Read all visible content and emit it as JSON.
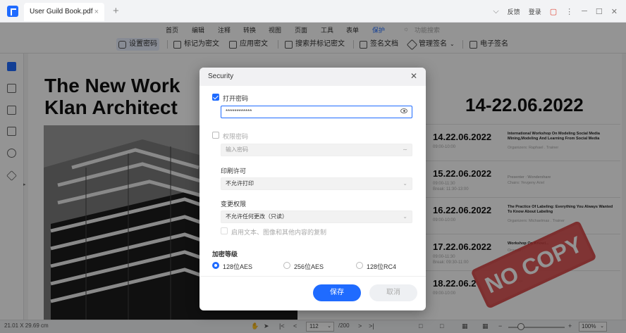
{
  "titlebar": {
    "tab_title": "User Guild Book.pdf",
    "close": "×",
    "new_tab": "+",
    "feedback": "反馈",
    "login": "登录",
    "more": "⋮",
    "minimize": "─",
    "maximize": "☐",
    "close_window": "✕",
    "chevron": "⌵"
  },
  "menu": {
    "items": [
      "首页",
      "编辑",
      "注释",
      "转换",
      "视图",
      "页面",
      "工具",
      "表单",
      "保护"
    ],
    "active": "保护",
    "search_placeholder": "功能搜索"
  },
  "toolbar": {
    "items": [
      "设置密码",
      "标记为密文",
      "应用密文",
      "搜索并标记密文",
      "签名文档",
      "管理签名",
      "电子签名"
    ]
  },
  "document": {
    "title_line1": "The New Work",
    "title_line2": "Klan Architect",
    "date_range": "14-22.06.2022",
    "schedule": [
      {
        "date": "14.22.06.2022",
        "time": "09:00-10:00",
        "title": "International Workshop On Modeling Social Media Mining,Modeling And Learning From Social Media",
        "organizer": "Organizers: Raphael . Trainer"
      },
      {
        "date": "15.22.06.2022",
        "time": "09:00-11:30",
        "break": "Break: 11:30-13:00",
        "title": "Presenter : Wondershare",
        "organizer": "Chairs: Yevgeny Ariel"
      },
      {
        "date": "16.22.06.2022",
        "time": "09:00-10:00",
        "title": "The Practice Of Labeling: Everything You Always Wanted To Know About Labeling",
        "organizer": "Organizers: Michaelmas . Trainer"
      },
      {
        "date": "17.22.06.2022",
        "time": "09:00-11:30",
        "break": "Break: 09:30-11:00",
        "title": "Workshop On Knowl...",
        "organizer": "Organiz..."
      },
      {
        "date": "18.22.06.2",
        "time": "09:00-10:00",
        "title": "",
        "organizer": "...Trainer"
      }
    ],
    "stamp": "NO COPY"
  },
  "status": {
    "page_size": "21.01 X 29.69 cm",
    "current_page": "112",
    "total_pages": "/200",
    "zoom": "100%"
  },
  "dialog": {
    "title": "Security",
    "open_password_label": "打开密码",
    "open_password_value": "************",
    "permission_password_label": "权限密码",
    "permission_placeholder": "输入密码",
    "print_label": "印刷许可",
    "print_value": "不允许打印",
    "change_label": "变更权限",
    "change_value": "不允许任何更改（只读）",
    "copy_label": "启用文本、图像和其他内容的复制",
    "encryption_label": "加密等级",
    "enc_options": [
      "128位AES",
      "256位AES",
      "128位RC4"
    ],
    "save": "保存",
    "cancel": "取消"
  }
}
